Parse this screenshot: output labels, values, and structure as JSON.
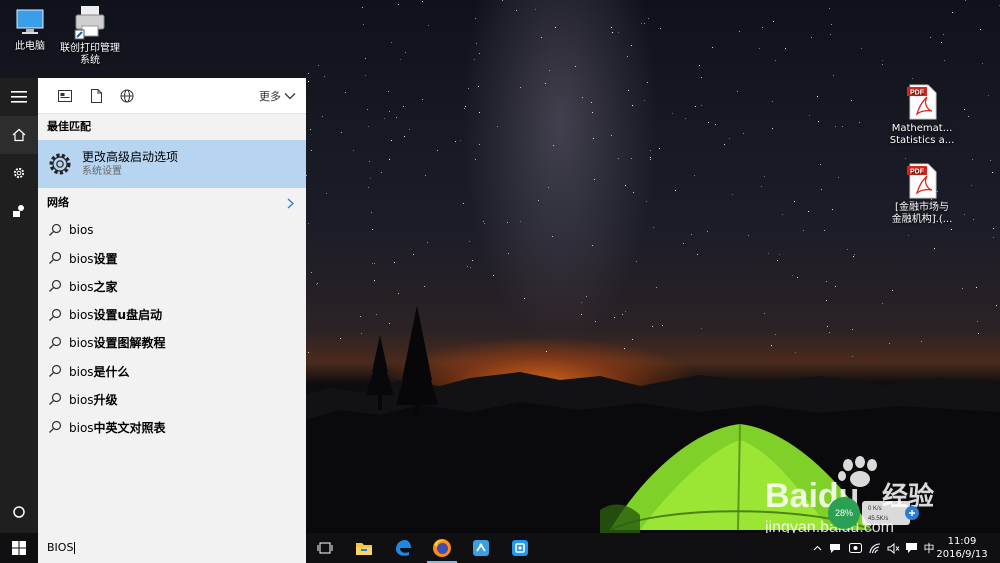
{
  "desktop": {
    "icons_left": [
      {
        "label": "此电脑",
        "icon": "computer-icon"
      },
      {
        "label_line1": "联创打印管理",
        "label_line2": "系统",
        "icon": "printer-icon"
      }
    ],
    "icons_right": [
      {
        "label_line1": "Mathemat...",
        "label_line2": "Statistics a...",
        "icon": "pdf-file-icon"
      },
      {
        "label_line1": "[金融市场与",
        "label_line2": "金融机构].(...",
        "icon": "pdf-file-icon"
      }
    ],
    "pdf_badge": "PDF"
  },
  "rail": {
    "items": [
      "hamburger-icon",
      "home-icon",
      "gear-icon",
      "feedback-icon",
      "cortana-icon"
    ]
  },
  "search_panel": {
    "filters": [
      "apps-filter-icon",
      "documents-filter-icon",
      "web-filter-icon"
    ],
    "more_label": "更多",
    "best_match_heading": "最佳匹配",
    "best_match": {
      "title": "更改高级启动选项",
      "subtitle": "系统设置",
      "icon": "gear-icon"
    },
    "web_heading": "网络",
    "suggestions": [
      {
        "prefix": "bios",
        "suffix": ""
      },
      {
        "prefix": "bios",
        "suffix": "设置"
      },
      {
        "prefix": "bios",
        "suffix": "之家"
      },
      {
        "prefix": "bios",
        "suffix": "设置u盘启动"
      },
      {
        "prefix": "bios",
        "suffix": "设置图解教程"
      },
      {
        "prefix": "bios",
        "suffix": "是什么"
      },
      {
        "prefix": "bios",
        "suffix": "升级"
      },
      {
        "prefix": "bios",
        "suffix": "中英文对照表"
      }
    ]
  },
  "taskbar": {
    "search_value": "BIOS",
    "apps": [
      "task-view-icon",
      "file-explorer-icon",
      "edge-icon",
      "firefox-icon",
      "network-app-icon",
      "baidu-app-icon"
    ],
    "tray": {
      "ime": "中"
    },
    "clock": {
      "time": "11:09",
      "date": "2016/9/13"
    }
  },
  "widgets": {
    "cpu_percent": "28%",
    "upload_speed": "0 K/s",
    "download_speed": "45.5K/s"
  },
  "watermark": {
    "brand": "Baidu",
    "brand_cn": "经验",
    "url": "jingyan.baidu.com"
  },
  "colors": {
    "panel_bg": "#f2f2f2",
    "best_match_bg": "#b7d5f0",
    "rail_bg": "#1f1f1f",
    "taskbar_bg": "#101012",
    "accent": "#2b7cd3"
  }
}
